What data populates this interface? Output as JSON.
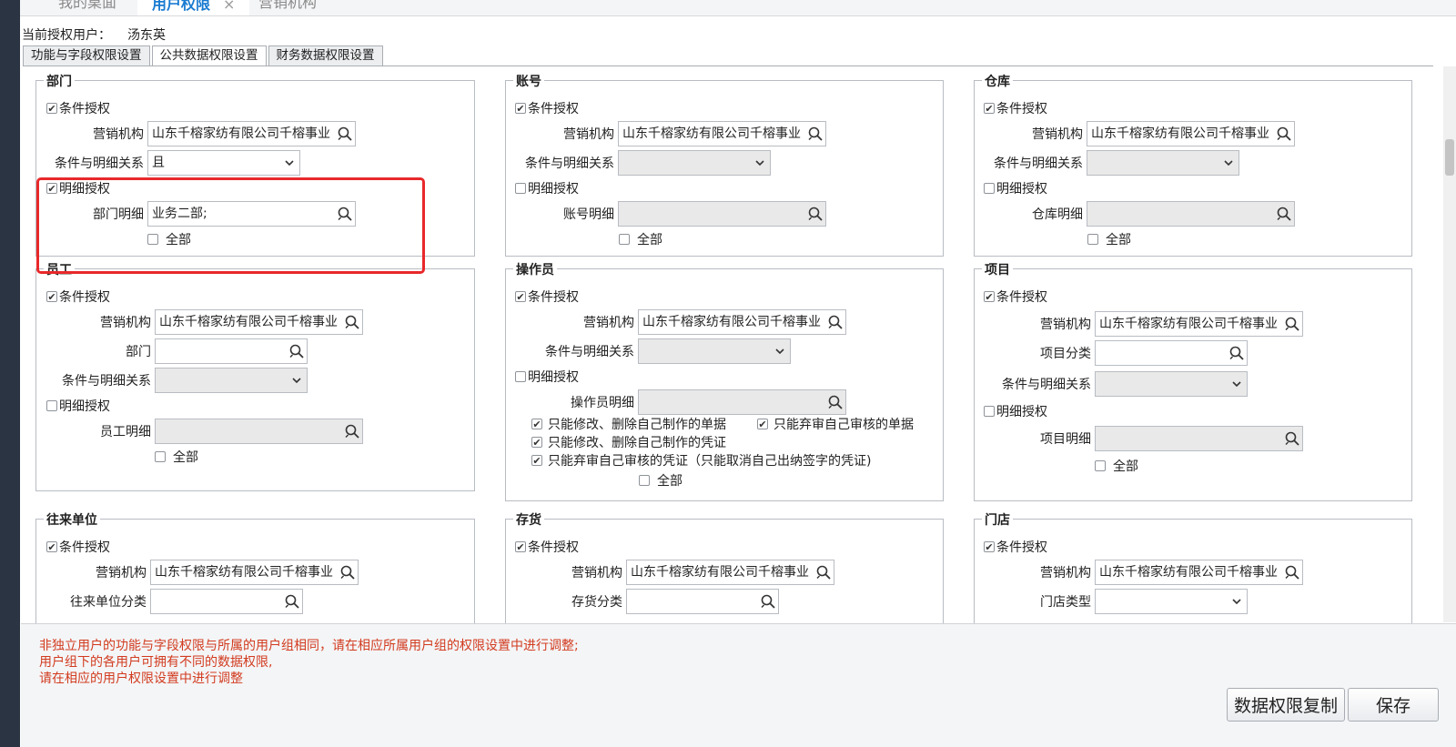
{
  "topbar": {
    "tabs": [
      {
        "label": "我的桌面"
      },
      {
        "label": "用户权限",
        "close": "×"
      },
      {
        "label": "营销机构"
      }
    ]
  },
  "user": {
    "label": "当前授权用户：",
    "value": "汤东英"
  },
  "subtabs": [
    "功能与字段权限设置",
    "公共数据权限设置",
    "财务数据权限设置"
  ],
  "common": {
    "cond_auth": "条件授权",
    "detail_auth": "明细授权",
    "org": "营销机构",
    "relation": "条件与明细关系",
    "all": "全部",
    "org_value": "山东千榕家纺有限公司千榕事业"
  },
  "dept": {
    "title": "部门",
    "relation_value": "且",
    "detail_label": "部门明细",
    "detail_value": "业务二部;"
  },
  "account": {
    "title": "账号",
    "detail_label": "账号明细"
  },
  "warehouse": {
    "title": "仓库",
    "detail_label": "仓库明细"
  },
  "employee": {
    "title": "员工",
    "dept_label": "部门",
    "detail_label": "员工明细"
  },
  "operator": {
    "title": "操作员",
    "detail_label": "操作员明细",
    "opt1": "只能修改、删除自己制作的单据",
    "opt2": "只能弃审自己审核的单据",
    "opt3": "只能修改、删除自己制作的凭证",
    "opt4": "只能弃审自己审核的凭证（只能取消自己出纳签字的凭证)"
  },
  "project": {
    "title": "项目",
    "category_label": "项目分类",
    "detail_label": "项目明细"
  },
  "partner": {
    "title": "往来单位",
    "category_label": "往来单位分类"
  },
  "inventory": {
    "title": "存货",
    "category_label": "存货分类"
  },
  "store": {
    "title": "门店",
    "type_label": "门店类型"
  },
  "notes": [
    "非独立用户的功能与字段权限与所属的用户组相同，请在相应所属用户组的权限设置中进行调整;",
    "用户组下的各用户可拥有不同的数据权限,",
    "请在相应的用户权限设置中进行调整"
  ],
  "buttons": {
    "copy": "数据权限复制",
    "save": "保存"
  },
  "colors": {
    "accent": "#1a7bd1",
    "note": "#d23b1f",
    "highlight": "#e8282b"
  }
}
